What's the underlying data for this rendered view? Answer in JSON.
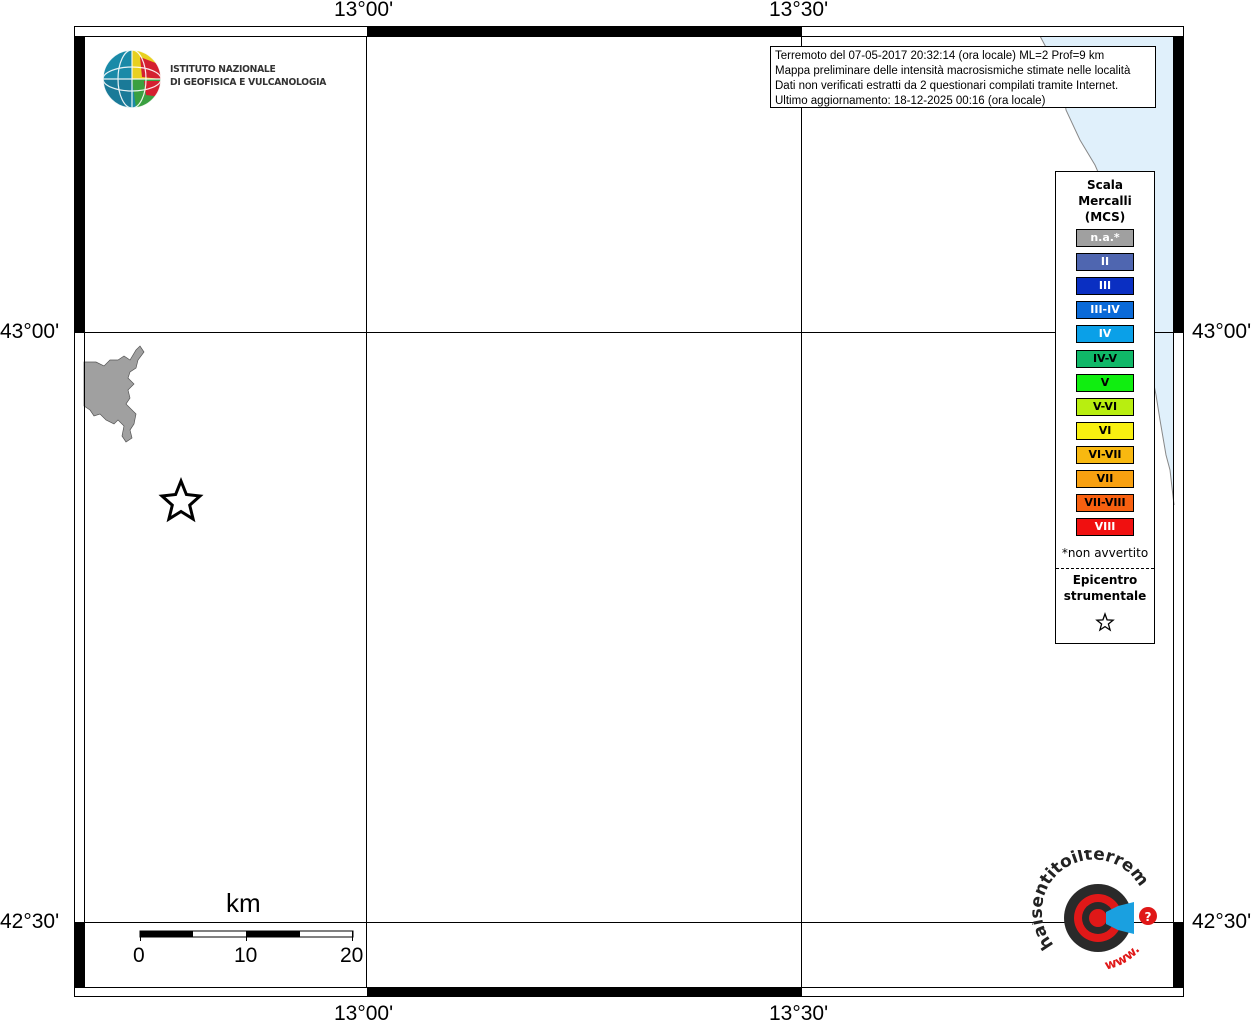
{
  "map": {
    "lon_labels": [
      "13°00'",
      "13°30'"
    ],
    "lat_labels": [
      "43°00'",
      "42°30'"
    ]
  },
  "info": {
    "lines": [
      "Terremoto del 07-05-2017 20:32:14 (ora locale) ML=2 Prof=9 km",
      "Mappa preliminare delle intensità macrosismiche stimate nelle località",
      "Dati non verificati estratti da 2 questionari compilati tramite Internet.",
      "Ultimo aggiornamento: 18-12-2025 00:16 (ora locale)"
    ]
  },
  "legend": {
    "title_lines": [
      "Scala",
      "Mercalli",
      "(MCS)"
    ],
    "items": [
      {
        "label": "n.a.*",
        "color": "#a0a0a0",
        "text_color": "#ffffff"
      },
      {
        "label": "II",
        "color": "#4f66b0",
        "text_color": "#ffffff"
      },
      {
        "label": "III",
        "color": "#0a2fc2",
        "text_color": "#ffffff"
      },
      {
        "label": "III-IV",
        "color": "#0a6ad8",
        "text_color": "#ffffff"
      },
      {
        "label": "IV",
        "color": "#0aa0e8",
        "text_color": "#ffffff"
      },
      {
        "label": "IV-V",
        "color": "#10b868",
        "text_color": "#000000"
      },
      {
        "label": "V",
        "color": "#10ee10",
        "text_color": "#000000"
      },
      {
        "label": "V-VI",
        "color": "#b8ee10",
        "text_color": "#000000"
      },
      {
        "label": "VI",
        "color": "#f8f010",
        "text_color": "#000000"
      },
      {
        "label": "VI-VII",
        "color": "#f8b810",
        "text_color": "#000000"
      },
      {
        "label": "VII",
        "color": "#f8a010",
        "text_color": "#000000"
      },
      {
        "label": "VII-VIII",
        "color": "#f86010",
        "text_color": "#000000"
      },
      {
        "label": "VIII",
        "color": "#f01010",
        "text_color": "#ffffff"
      }
    ],
    "note": "*non avvertito",
    "epicentre_lines": [
      "Epicentro",
      "strumentale"
    ]
  },
  "ingv_logo": {
    "lines": [
      "ISTITUTO NAZIONALE",
      "DI GEOFISICA E VULCANOLOGIA"
    ]
  },
  "scale_bar": {
    "unit": "km",
    "ticks": [
      "0",
      "10",
      "20"
    ]
  },
  "hst_logo": {
    "text": "haisentitoilterremoto.it",
    "prefix": "www."
  },
  "colors": {
    "sea": "#e0f0fb",
    "urban_area": "#a0a0a0",
    "frame": "#000000"
  }
}
